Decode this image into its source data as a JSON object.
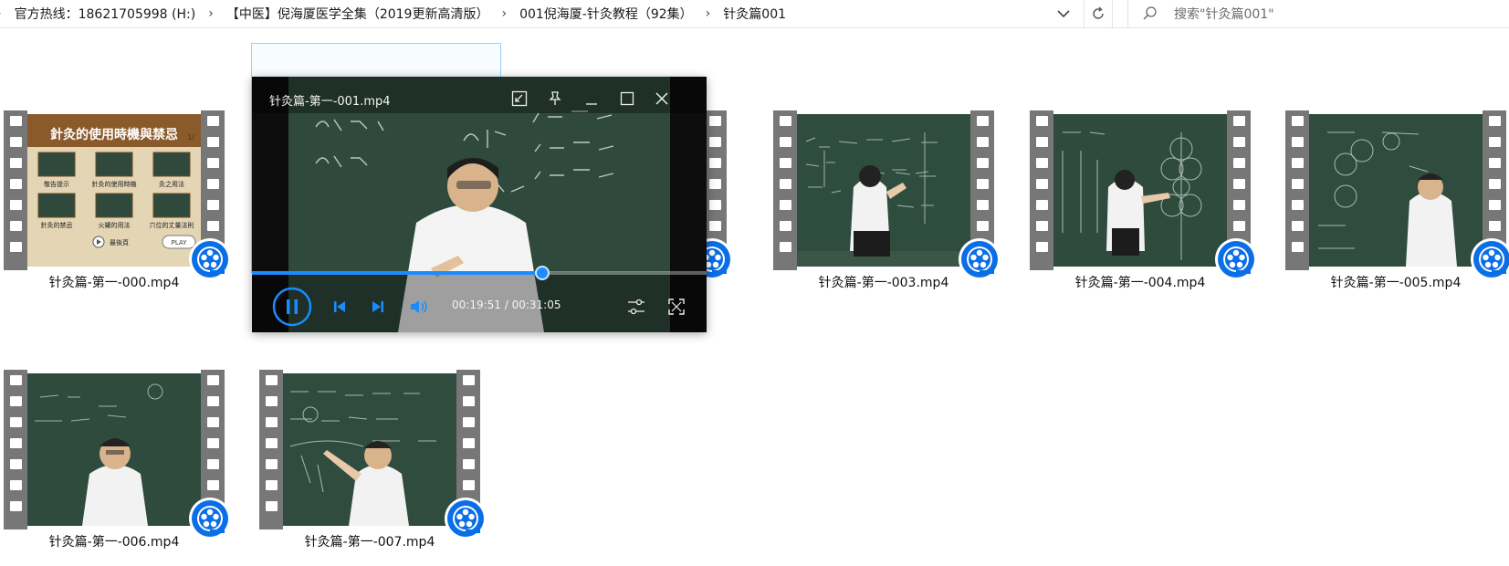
{
  "address": {
    "crumbs": [
      "官方热线：18621705998 (H:)",
      "【中医】倪海厦医学全集（2019更新高清版）",
      "001倪海厦-针灸教程（92集）",
      "针灸篇001"
    ],
    "search_placeholder": "搜索\"针灸篇001\""
  },
  "files": [
    {
      "name": "针灸篇-第一-000.mp4",
      "thumb": "menu"
    },
    {
      "name": "针灸篇-第一-003.mp4",
      "thumb": "back"
    },
    {
      "name": "针灸篇-第一-004.mp4",
      "thumb": "back"
    },
    {
      "name": "针灸篇-第一-005.mp4",
      "thumb": "front"
    },
    {
      "name": "针灸篇-第一-006.mp4",
      "thumb": "front"
    },
    {
      "name": "针灸篇-第一-007.mp4",
      "thumb": "point"
    }
  ],
  "thumb_menu": {
    "title": "針灸的使用時機與禁忌",
    "page": "1/",
    "items": [
      "敬告提示",
      "針灸的使用時機",
      "灸之用法",
      "針灸的禁忌",
      "火罐的用法",
      "穴位的丈量法則"
    ],
    "bottom_label": "最後頁",
    "play_label": "PLAY"
  },
  "player": {
    "title": "针灸篇-第一-001.mp4",
    "elapsed": "00:19:51",
    "total": "00:31:05",
    "progress_fraction": 0.638,
    "colors": {
      "accent": "#1a8cff",
      "board": "#2f4a3d"
    }
  },
  "icons": {
    "dropdown": "chevron-down-icon",
    "refresh": "refresh-icon",
    "search": "search-icon",
    "badge": "video-player-app-icon"
  }
}
